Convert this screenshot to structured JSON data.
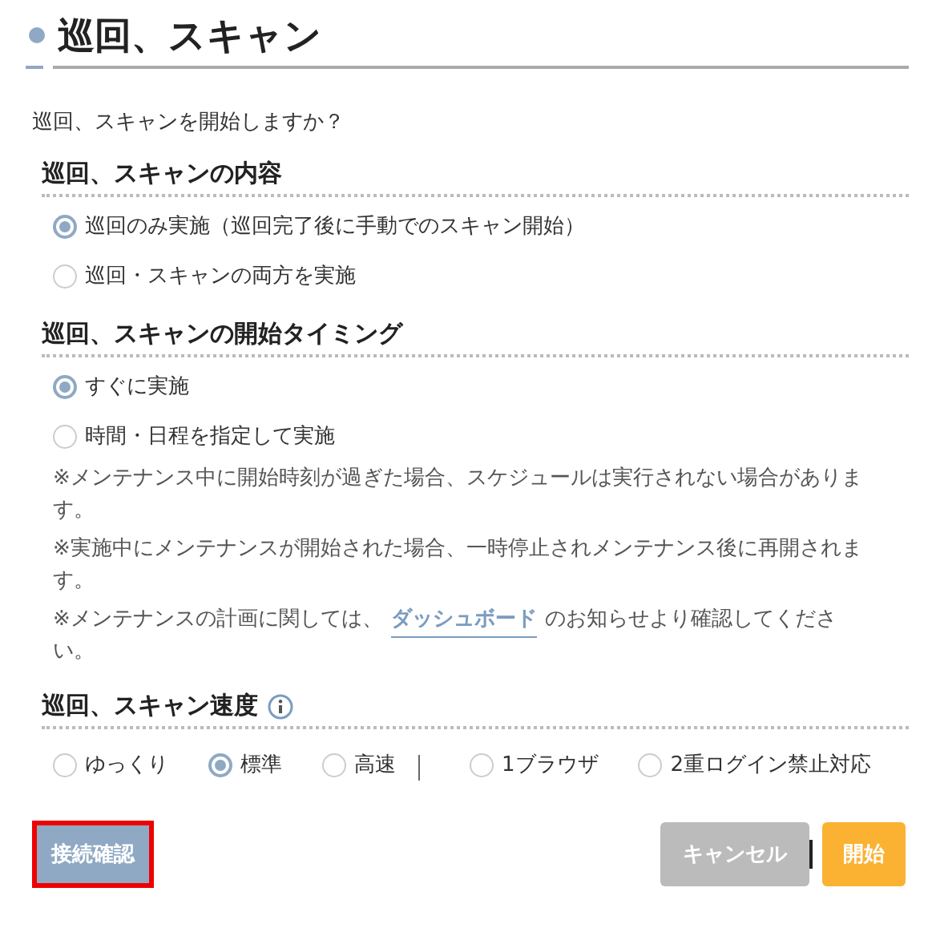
{
  "title": "巡回、スキャン",
  "question": "巡回、スキャンを開始しますか？",
  "sections": [
    {
      "kind": "radios",
      "heading": "巡回、スキャンの内容",
      "options": [
        {
          "label": "巡回のみ実施（巡回完了後に手動でのスキャン開始）",
          "selected": true
        },
        {
          "label": "巡回・スキャンの両方を実施",
          "selected": false
        }
      ]
    },
    {
      "kind": "radios",
      "heading": "巡回、スキャンの開始タイミング",
      "options": [
        {
          "label": "すぐに実施",
          "selected": true
        },
        {
          "label": "時間・日程を指定して実施",
          "selected": false
        }
      ],
      "notes": [
        {
          "text": "※メンテナンス中に開始時刻が過ぎた場合、スケジュールは実行されない場合があります。"
        },
        {
          "text": "※実施中にメンテナンスが開始された場合、一時停止されメンテナンス後に再開されます。"
        },
        {
          "text": "※メンテナンスの計画に関しては、",
          "link": "ダッシュボード",
          "after": "のお知らせより確認してください。"
        }
      ]
    },
    {
      "kind": "inline",
      "heading": "巡回、スキャン速度",
      "info": true,
      "groups": [
        [
          {
            "label": "ゆっくり",
            "selected": false
          },
          {
            "label": "標準",
            "selected": true
          },
          {
            "label": "高速",
            "selected": false
          }
        ],
        [
          {
            "label": "1ブラウザ",
            "selected": false
          },
          {
            "label": "2重ログイン禁止対応",
            "selected": false
          }
        ]
      ]
    }
  ],
  "buttons": {
    "check": {
      "label": "接続確認",
      "highlighted": true
    },
    "cancel": {
      "label": "キャンセル"
    },
    "start": {
      "label": "開始"
    }
  }
}
